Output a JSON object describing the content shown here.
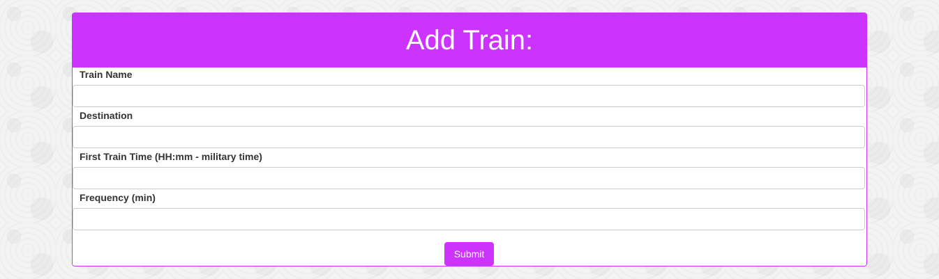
{
  "form": {
    "title": "Add Train:",
    "accent_color": "#cc33ff",
    "fields": [
      {
        "label": "Train Name",
        "value": "",
        "placeholder": ""
      },
      {
        "label": "Destination",
        "value": "",
        "placeholder": ""
      },
      {
        "label": "First Train Time (HH:mm - military time)",
        "value": "",
        "placeholder": ""
      },
      {
        "label": "Frequency (min)",
        "value": "",
        "placeholder": ""
      }
    ],
    "submit_label": "Submit"
  }
}
